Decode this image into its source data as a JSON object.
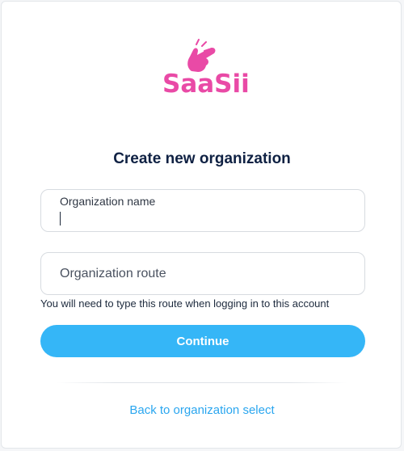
{
  "brand": {
    "logo_text": "SaaSii",
    "logo_icon": "hand-snap-icon",
    "color": "#e94aa6"
  },
  "title": "Create new organization",
  "form": {
    "name_field": {
      "label": "Organization name",
      "value": ""
    },
    "route_field": {
      "placeholder": "Organization route",
      "value": ""
    },
    "route_hint": "You will need to type this route when logging in to this account",
    "continue_label": "Continue"
  },
  "back_link": "Back to organization select",
  "colors": {
    "accent": "#35b6f7",
    "link": "#2aa6ef",
    "title": "#0f2143"
  }
}
